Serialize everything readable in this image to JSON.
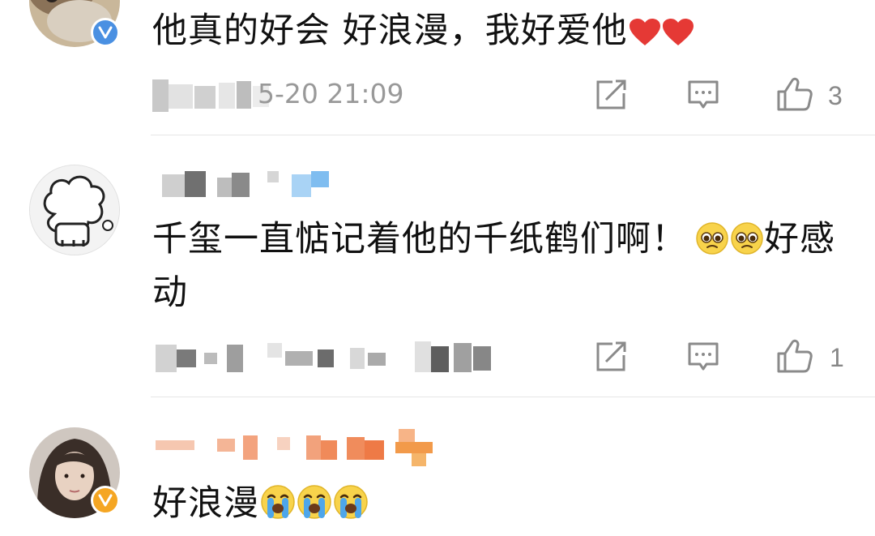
{
  "comments": [
    {
      "content_text": "他真的好会 好浪漫，我好爱他",
      "trailing_emojis": [
        "red-heart",
        "red-heart"
      ],
      "time": "5-20 21:09",
      "likes": "3",
      "verified": "blue-v"
    },
    {
      "content_text_1": "千玺一直惦记着他的千纸鹤们啊！",
      "content_text_2": "好感",
      "content_text_3": "动",
      "inline_emojis": [
        "pleading-face",
        "pleading-face"
      ],
      "likes": "1"
    },
    {
      "content_text": "好浪漫",
      "trailing_emojis": [
        "loudly-crying-face",
        "loudly-crying-face",
        "loudly-crying-face"
      ],
      "verified": "gold-v"
    }
  ],
  "colors": {
    "icon_gray": "#8a8a8a",
    "divider": "#e6e6e6",
    "verified_blue": "#4a90e2",
    "verified_gold": "#f5a623",
    "heart_red": "#e53935"
  }
}
